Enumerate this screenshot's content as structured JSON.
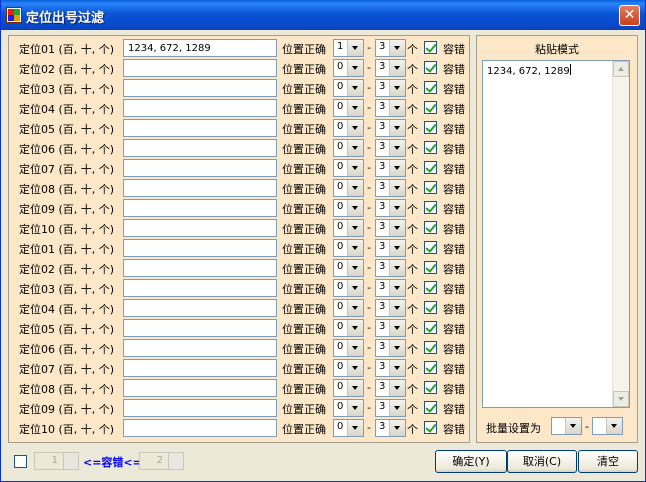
{
  "window": {
    "title": "定位出号过滤",
    "close_glyph": "✕"
  },
  "rows": [
    {
      "label": "定位01 (百, 十, 个)",
      "value": "1234, 672, 1289",
      "min": "1",
      "max": "3"
    },
    {
      "label": "定位02 (百, 十, 个)",
      "value": "",
      "min": "0",
      "max": "3"
    },
    {
      "label": "定位03 (百, 十, 个)",
      "value": "",
      "min": "0",
      "max": "3"
    },
    {
      "label": "定位04 (百, 十, 个)",
      "value": "",
      "min": "0",
      "max": "3"
    },
    {
      "label": "定位05 (百, 十, 个)",
      "value": "",
      "min": "0",
      "max": "3"
    },
    {
      "label": "定位06 (百, 十, 个)",
      "value": "",
      "min": "0",
      "max": "3"
    },
    {
      "label": "定位07 (百, 十, 个)",
      "value": "",
      "min": "0",
      "max": "3"
    },
    {
      "label": "定位08 (百, 十, 个)",
      "value": "",
      "min": "0",
      "max": "3"
    },
    {
      "label": "定位09 (百, 十, 个)",
      "value": "",
      "min": "0",
      "max": "3"
    },
    {
      "label": "定位10 (百, 十, 个)",
      "value": "",
      "min": "0",
      "max": "3"
    },
    {
      "label": "定位01 (百, 十, 个)",
      "value": "",
      "min": "0",
      "max": "3"
    },
    {
      "label": "定位02 (百, 十, 个)",
      "value": "",
      "min": "0",
      "max": "3"
    },
    {
      "label": "定位03 (百, 十, 个)",
      "value": "",
      "min": "0",
      "max": "3"
    },
    {
      "label": "定位04 (百, 十, 个)",
      "value": "",
      "min": "0",
      "max": "3"
    },
    {
      "label": "定位05 (百, 十, 个)",
      "value": "",
      "min": "0",
      "max": "3"
    },
    {
      "label": "定位06 (百, 十, 个)",
      "value": "",
      "min": "0",
      "max": "3"
    },
    {
      "label": "定位07 (百, 十, 个)",
      "value": "",
      "min": "0",
      "max": "3"
    },
    {
      "label": "定位08 (百, 十, 个)",
      "value": "",
      "min": "0",
      "max": "3"
    },
    {
      "label": "定位09 (百, 十, 个)",
      "value": "",
      "min": "0",
      "max": "3"
    },
    {
      "label": "定位10 (百, 十, 个)",
      "value": "",
      "min": "0",
      "max": "3"
    }
  ],
  "row_common": {
    "position_label": "位置正确",
    "dash": "-",
    "unit": "个",
    "tolerance_label": "容错",
    "tolerance_checked": true
  },
  "paste": {
    "title": "粘贴模式",
    "text": "1234, 672, 1289",
    "batch_label": "批量设置为",
    "batch_dash": "-",
    "batch_min": "",
    "batch_max": ""
  },
  "bottom": {
    "tolerance_enabled": false,
    "tol_min": "1",
    "tol_max": "2",
    "tol_range_label": "<=容错<="
  },
  "buttons": {
    "ok": "确定(Y)",
    "cancel": "取消(C)",
    "clear": "清空"
  },
  "colors": {
    "panel_bg": "#fde7c9",
    "title_bar": "#0b55d6",
    "accent_text": "#0000ff",
    "check": "#21a121"
  }
}
